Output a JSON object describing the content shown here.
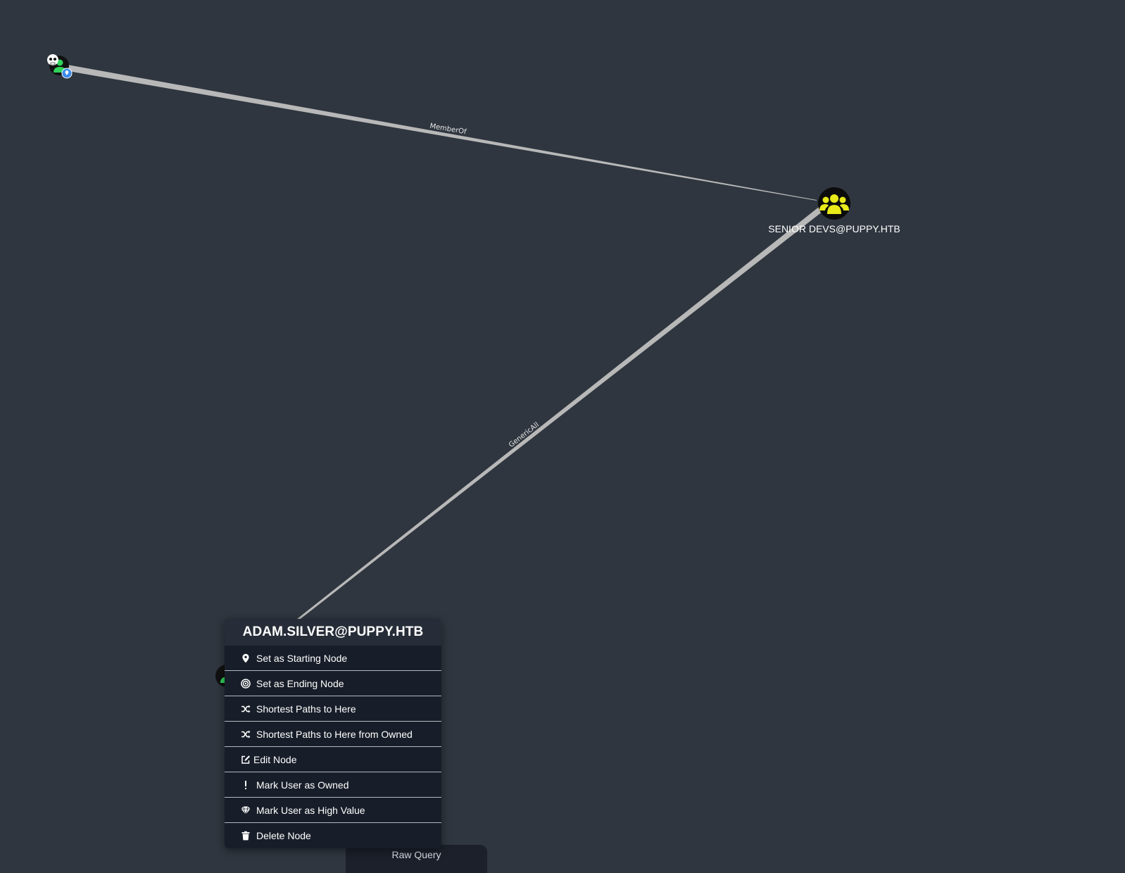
{
  "graph": {
    "edges": [
      {
        "label": "MemberOf"
      },
      {
        "label": "GenericAll"
      }
    ],
    "nodes": {
      "owned_user": {
        "type": "user",
        "icon": "user-icon",
        "owned": true,
        "starting_node": true
      },
      "group": {
        "type": "group",
        "icon": "group-icon",
        "label": "SENIOR DEVS@PUPPY.HTB",
        "color": "#e8ea1a"
      },
      "adam_silver": {
        "type": "user",
        "icon": "user-icon",
        "color": "#2fd35a"
      }
    }
  },
  "context_menu": {
    "title": "ADAM.SILVER@PUPPY.HTB",
    "items": [
      {
        "label": "Set as Starting Node",
        "icon": "map-marker-icon"
      },
      {
        "label": "Set as Ending Node",
        "icon": "bullseye-icon"
      },
      {
        "label": "Shortest Paths to Here",
        "icon": "random-icon"
      },
      {
        "label": "Shortest Paths to Here from Owned",
        "icon": "random-icon"
      },
      {
        "label": "Edit Node",
        "icon": "edit-icon"
      },
      {
        "label": "Mark User as Owned",
        "icon": "exclamation-icon"
      },
      {
        "label": "Mark User as High Value",
        "icon": "gem-icon"
      },
      {
        "label": "Delete Node",
        "icon": "trash-icon"
      }
    ]
  },
  "raw_query": {
    "label": "Raw Query"
  },
  "colors": {
    "background": "#2f363f",
    "menu_background": "#181e29",
    "menu_header": "#262d38",
    "edge": "#b8b8b8",
    "user_green": "#2fd35a",
    "group_yellow": "#e8ea1a",
    "start_marker_blue": "#3a8bea"
  }
}
